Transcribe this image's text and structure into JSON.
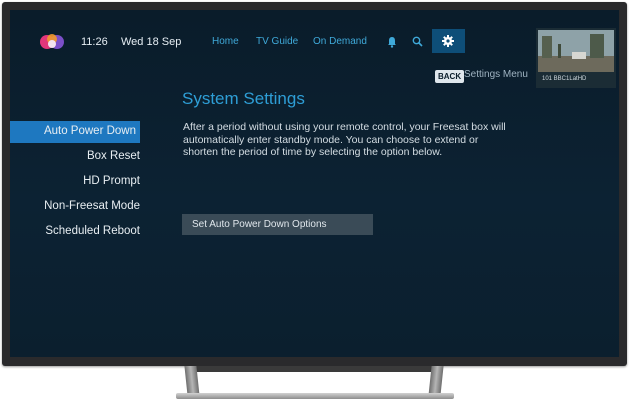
{
  "status": {
    "time": "11:26",
    "date": "Wed 18 Sep"
  },
  "nav": {
    "items": [
      "Home",
      "TV Guide",
      "On Demand"
    ]
  },
  "header": {
    "back_label": "BACK",
    "breadcrumb": "Settings Menu"
  },
  "preview": {
    "channel_caption": "101 BBC1LatHD"
  },
  "page": {
    "title": "System Settings",
    "description": "After a period without using your remote control, your Freesat box will automatically enter standby mode. You can choose to extend or shorten the period of time by selecting the option below.",
    "option_button": "Set Auto Power Down Options"
  },
  "sidebar": {
    "items": [
      {
        "label": "Auto Power Down",
        "active": true
      },
      {
        "label": "Box Reset",
        "active": false
      },
      {
        "label": "HD Prompt",
        "active": false
      },
      {
        "label": "Non-Freesat Mode",
        "active": false
      },
      {
        "label": "Scheduled Reboot",
        "active": false
      }
    ]
  },
  "colors": {
    "accent": "#1e78c0",
    "title": "#2e9ed6",
    "nav": "#3fa9d9",
    "background": "#0c2233"
  },
  "icons": [
    "freesat-logo-icon",
    "bell-icon",
    "search-icon",
    "gear-icon"
  ]
}
